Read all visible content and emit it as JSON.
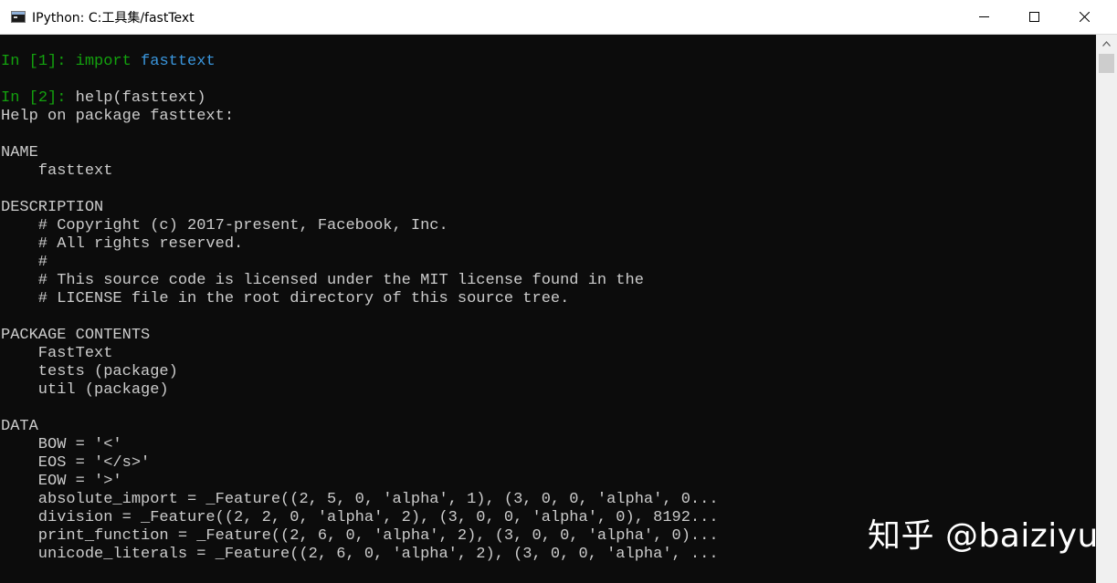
{
  "window": {
    "title": "IPython: C:工具集/fastText",
    "icon": "console-app-icon",
    "controls": [
      "minimize-icon",
      "maximize-icon",
      "close-icon"
    ]
  },
  "console": {
    "lines": [
      {
        "segments": [
          {
            "text": "In [",
            "color": "green"
          },
          {
            "text": "1",
            "color": "green"
          },
          {
            "text": "]: ",
            "color": "green"
          },
          {
            "text": "import ",
            "color": "green"
          },
          {
            "text": "fasttext",
            "color": "cyan"
          }
        ]
      },
      {
        "segments": [
          {
            "text": "",
            "color": "gray"
          }
        ]
      },
      {
        "segments": [
          {
            "text": "In [",
            "color": "green"
          },
          {
            "text": "2",
            "color": "green"
          },
          {
            "text": "]: ",
            "color": "green"
          },
          {
            "text": "help(fasttext)",
            "color": "gray"
          }
        ]
      },
      {
        "segments": [
          {
            "text": "Help on package fasttext:",
            "color": "gray"
          }
        ]
      },
      {
        "segments": [
          {
            "text": "",
            "color": "gray"
          }
        ]
      },
      {
        "segments": [
          {
            "text": "NAME",
            "color": "gray"
          }
        ]
      },
      {
        "segments": [
          {
            "text": "    fasttext",
            "color": "gray"
          }
        ]
      },
      {
        "segments": [
          {
            "text": "",
            "color": "gray"
          }
        ]
      },
      {
        "segments": [
          {
            "text": "DESCRIPTION",
            "color": "gray"
          }
        ]
      },
      {
        "segments": [
          {
            "text": "    # Copyright (c) 2017-present, Facebook, Inc.",
            "color": "gray"
          }
        ]
      },
      {
        "segments": [
          {
            "text": "    # All rights reserved.",
            "color": "gray"
          }
        ]
      },
      {
        "segments": [
          {
            "text": "    #",
            "color": "gray"
          }
        ]
      },
      {
        "segments": [
          {
            "text": "    # This source code is licensed under the MIT license found in the",
            "color": "gray"
          }
        ]
      },
      {
        "segments": [
          {
            "text": "    # LICENSE file in the root directory of this source tree.",
            "color": "gray"
          }
        ]
      },
      {
        "segments": [
          {
            "text": "",
            "color": "gray"
          }
        ]
      },
      {
        "segments": [
          {
            "text": "PACKAGE CONTENTS",
            "color": "gray"
          }
        ]
      },
      {
        "segments": [
          {
            "text": "    FastText",
            "color": "gray"
          }
        ]
      },
      {
        "segments": [
          {
            "text": "    tests (package)",
            "color": "gray"
          }
        ]
      },
      {
        "segments": [
          {
            "text": "    util (package)",
            "color": "gray"
          }
        ]
      },
      {
        "segments": [
          {
            "text": "",
            "color": "gray"
          }
        ]
      },
      {
        "segments": [
          {
            "text": "DATA",
            "color": "gray"
          }
        ]
      },
      {
        "segments": [
          {
            "text": "    BOW = '<'",
            "color": "gray"
          }
        ]
      },
      {
        "segments": [
          {
            "text": "    EOS = '</s>'",
            "color": "gray"
          }
        ]
      },
      {
        "segments": [
          {
            "text": "    EOW = '>'",
            "color": "gray"
          }
        ]
      },
      {
        "segments": [
          {
            "text": "    absolute_import = _Feature((2, 5, 0, 'alpha', 1), (3, 0, 0, 'alpha', 0...",
            "color": "gray"
          }
        ]
      },
      {
        "segments": [
          {
            "text": "    division = _Feature((2, 2, 0, 'alpha', 2), (3, 0, 0, 'alpha', 0), 8192...",
            "color": "gray"
          }
        ]
      },
      {
        "segments": [
          {
            "text": "    print_function = _Feature((2, 6, 0, 'alpha', 2), (3, 0, 0, 'alpha', 0)...",
            "color": "gray"
          }
        ]
      },
      {
        "segments": [
          {
            "text": "    unicode_literals = _Feature((2, 6, 0, 'alpha', 2), (3, 0, 0, 'alpha', ...",
            "color": "gray"
          }
        ]
      }
    ]
  },
  "colors": {
    "green": "#13a10e",
    "cyan": "#3a96dd",
    "gray": "#cccccc",
    "background": "#0c0c0c"
  },
  "scrollbar": {
    "icon": "scroll-up-arrow-icon"
  },
  "watermark": {
    "text": "知乎 @baiziyu"
  }
}
